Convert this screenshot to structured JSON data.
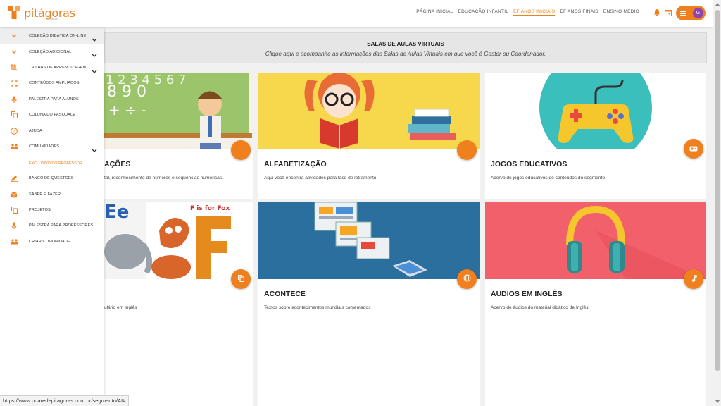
{
  "brand": {
    "name": "pitágoras",
    "sub": "REDE",
    "color": "#f07f1d"
  },
  "topnav": [
    {
      "label": "PÁGINA INICIAL",
      "active": false
    },
    {
      "label": "EDUCAÇÃO INFANTIL",
      "active": false
    },
    {
      "label": "EF ANOS INICIAIS",
      "active": true
    },
    {
      "label": "EF ANOS FINAIS",
      "active": false
    },
    {
      "label": "ENSINO MÉDIO",
      "active": false
    }
  ],
  "user": {
    "initial": "G"
  },
  "sidebar": {
    "items": [
      {
        "label": "COLEÇÃO DIDÁTICA ON-LINE",
        "icon": "chevron-icon",
        "has_chevron": true
      },
      {
        "label": "COLEÇÃO ADICIONAL",
        "icon": "chevron-icon",
        "has_chevron": true
      },
      {
        "label": "TRILHAS DE APRENDIZAGEM",
        "icon": "route-icon",
        "has_chevron": true
      },
      {
        "label": "CONTEÚDOS AMPLIADOS",
        "icon": "expand-icon",
        "has_chevron": false
      },
      {
        "label": "PALESTRA PARA ALUNOS",
        "icon": "microphone-icon",
        "has_chevron": false
      },
      {
        "label": "COLUNA DO PASQUALE",
        "icon": "copy-icon",
        "has_chevron": false
      },
      {
        "label": "AJUDA",
        "icon": "help-icon",
        "has_chevron": false
      },
      {
        "label": "COMUNIDADES",
        "icon": "group-icon",
        "has_chevron": true
      }
    ],
    "section_label": "EXCLUSIVO DO PROFESSOR",
    "items2": [
      {
        "label": "BANCO DE QUESTÕES",
        "icon": "pencil-icon"
      },
      {
        "label": "SABER E FAZER",
        "icon": "box-icon"
      },
      {
        "label": "PROJETOS",
        "icon": "copy-icon"
      },
      {
        "label": "PALESTRA PARA PROFESSORES",
        "icon": "microphone-icon"
      },
      {
        "label": "CRIAR COMUNIDADE",
        "icon": "group-icon"
      }
    ]
  },
  "banner": {
    "title": "SALAS DE AULAS VIRTUAIS",
    "subtitle": "Clique aqui e acompanhe as informações das Salas de Aulas Virtuais em que você é Gestor ou Coordenador."
  },
  "cards": [
    {
      "title": "AÇÕES",
      "desc": "tal, reconhecimento de números e sequências numéricas.",
      "icon": "circle-icon"
    },
    {
      "title": "ALFABETIZAÇÃO",
      "desc": "Aqui você encontra atividades para fase de letramento.",
      "icon": "circle-icon"
    },
    {
      "title": "JOGOS EDUCATIVOS",
      "desc": "Acervo de jogos educativos de conteúdos do segmento",
      "icon": "gamepad-icon"
    },
    {
      "title": "",
      "desc": "ulário em Inglês",
      "icon": "copy-icon",
      "image_text": "F is for Fox"
    },
    {
      "title": "ACONTECE",
      "desc": "Textos sobre acontecimentos mundiais comentados",
      "icon": "globe-icon"
    },
    {
      "title": "ÁUDIOS EM INGLÊS",
      "desc": "Acervo de áudios do material didático de Inglês",
      "icon": "music-icon"
    }
  ],
  "status_url": "https://www.pdaredepitagoras.com.br/segmento/AI#"
}
